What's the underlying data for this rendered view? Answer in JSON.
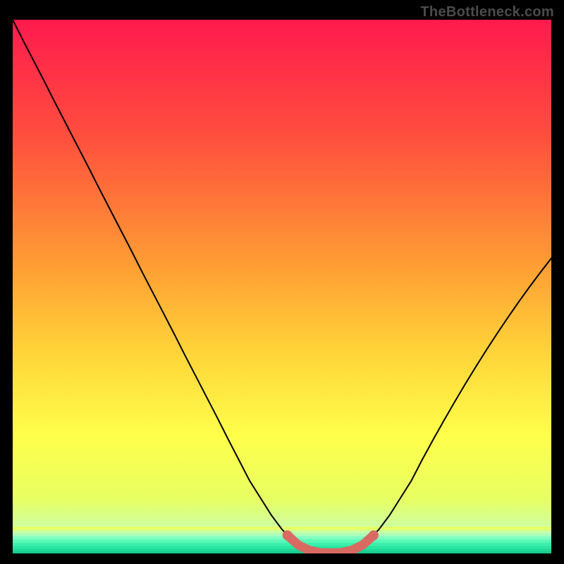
{
  "watermark": "TheBottleneck.com",
  "chart_data": {
    "type": "line",
    "title": "",
    "xlabel": "",
    "ylabel": "",
    "x_range": [
      0,
      100
    ],
    "y_range": [
      0,
      100
    ],
    "series": [
      {
        "name": "curve",
        "color": "#000000",
        "x": [
          0,
          2,
          4,
          6,
          8,
          10,
          12,
          14,
          16,
          18,
          20,
          22,
          24,
          26,
          28,
          30,
          32,
          34,
          36,
          38,
          40,
          42,
          44,
          46,
          48,
          50,
          52,
          54,
          56,
          58,
          60,
          62,
          64,
          66,
          68,
          70,
          72,
          74,
          76,
          78,
          80,
          82,
          84,
          86,
          88,
          90,
          92,
          94,
          96,
          98,
          100
        ],
        "y": [
          100,
          96,
          92.1,
          88.2,
          84.2,
          80.3,
          76.4,
          72.5,
          68.5,
          64.6,
          60.7,
          56.8,
          52.8,
          48.9,
          45,
          41.1,
          37.1,
          33.2,
          29.3,
          25.4,
          21.4,
          17.5,
          13.6,
          10.4,
          7.2,
          4.5,
          2.4,
          1.0,
          0.3,
          0.1,
          0.1,
          0.3,
          1.0,
          2.4,
          4.5,
          7.2,
          10.4,
          13.6,
          17.5,
          21.2,
          24.8,
          28.3,
          31.7,
          35.0,
          38.2,
          41.3,
          44.3,
          47.2,
          50.0,
          52.7,
          55.3
        ]
      },
      {
        "name": "highlight",
        "color": "#d86a62",
        "x": [
          51,
          53,
          55,
          57,
          59,
          61,
          63,
          65,
          67
        ],
        "y": [
          3.4,
          1.6,
          0.6,
          0.15,
          0.1,
          0.15,
          0.6,
          1.6,
          3.4
        ]
      }
    ],
    "gradient_stops": [
      {
        "offset": 0,
        "color": "#ff1a4d"
      },
      {
        "offset": 22,
        "color": "#ff4f3e"
      },
      {
        "offset": 45,
        "color": "#ff9a34"
      },
      {
        "offset": 62,
        "color": "#ffd338"
      },
      {
        "offset": 78,
        "color": "#ffff4a"
      },
      {
        "offset": 90,
        "color": "#e7ff63"
      },
      {
        "offset": 95.2,
        "color": "#ccffa3"
      },
      {
        "offset": 95.8,
        "color": "#aaffba"
      },
      {
        "offset": 96.4,
        "color": "#7fffc2"
      },
      {
        "offset": 97.0,
        "color": "#58f9b6"
      },
      {
        "offset": 97.8,
        "color": "#3bf0ac"
      },
      {
        "offset": 98.6,
        "color": "#28e5a1"
      },
      {
        "offset": 99.3,
        "color": "#1dd897"
      },
      {
        "offset": 100,
        "color": "#16cd8f"
      }
    ],
    "bands": [
      {
        "y0": 95.0,
        "y1": 95.6,
        "color": "#e7ff63"
      },
      {
        "y0": 95.6,
        "y1": 96.2,
        "color": "#ccffa3"
      },
      {
        "y0": 96.2,
        "y1": 96.8,
        "color": "#aaffba"
      },
      {
        "y0": 96.8,
        "y1": 97.4,
        "color": "#7fffc2"
      },
      {
        "y0": 97.4,
        "y1": 98.0,
        "color": "#58f9b6"
      },
      {
        "y0": 98.0,
        "y1": 98.6,
        "color": "#3bf0ac"
      },
      {
        "y0": 98.6,
        "y1": 99.2,
        "color": "#28e5a1"
      },
      {
        "y0": 99.2,
        "y1": 99.6,
        "color": "#1dd897"
      },
      {
        "y0": 99.6,
        "y1": 100,
        "color": "#16cd8f"
      }
    ]
  }
}
